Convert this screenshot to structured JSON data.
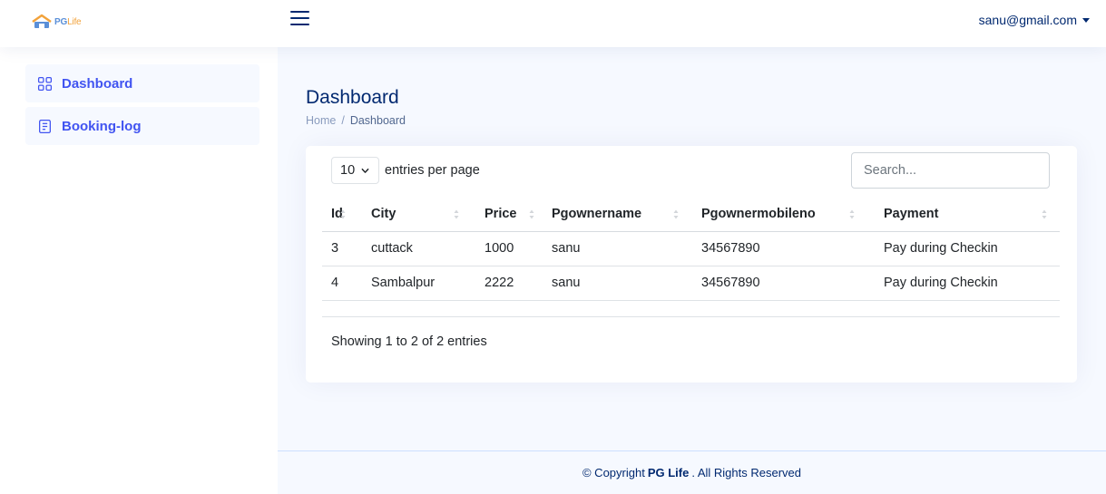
{
  "brand": {
    "name_pg": "PG",
    "name_life": "Life"
  },
  "header": {
    "user_email": "sanu@gmail.com"
  },
  "sidebar": {
    "items": [
      {
        "label": "Dashboard",
        "icon": "grid-icon"
      },
      {
        "label": "Booking-log",
        "icon": "journal-text-icon"
      }
    ]
  },
  "page": {
    "title": "Dashboard",
    "breadcrumb": {
      "home": "Home",
      "separator": "/",
      "current": "Dashboard"
    }
  },
  "table_controls": {
    "per_page_value": "10",
    "per_page_label": "entries per page",
    "search_placeholder": "Search..."
  },
  "table": {
    "columns": [
      "Id",
      "City",
      "Price",
      "Pgownername",
      "Pgownermobileno",
      "Payment"
    ],
    "rows": [
      [
        "3",
        "cuttack",
        "1000",
        "sanu",
        "34567890",
        "Pay during Checkin"
      ],
      [
        "4",
        "Sambalpur",
        "2222",
        "sanu",
        "34567890",
        "Pay during Checkin"
      ]
    ],
    "info": "Showing 1 to 2 of 2 entries"
  },
  "footer": {
    "prefix": "© Copyright",
    "brand": "PG Life",
    "suffix": ". All Rights Reserved"
  },
  "colors": {
    "accent": "#4154f1",
    "navy": "#012970",
    "background": "#f6f9ff",
    "logo_blue": "#5a8fd8",
    "logo_orange": "#f2a23a"
  }
}
